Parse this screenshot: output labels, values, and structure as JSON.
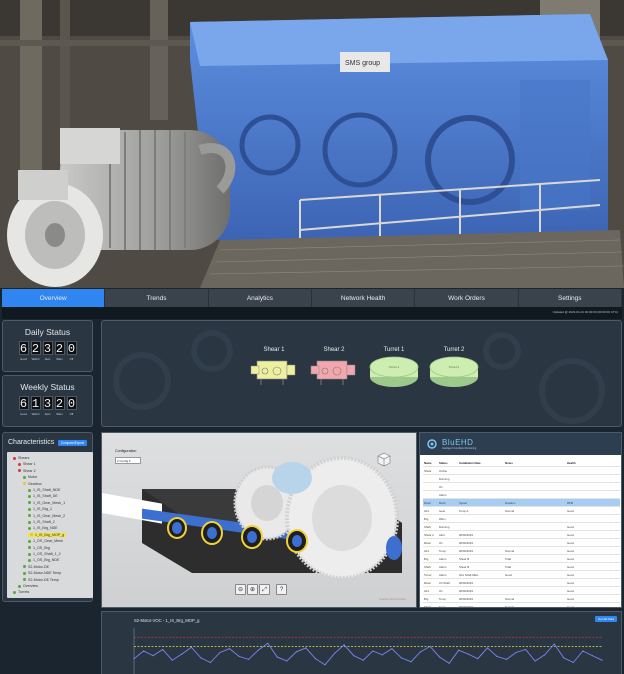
{
  "photo": {
    "nameplate": "SMS group"
  },
  "nav": {
    "tabs": [
      "Overview",
      "Trends",
      "Analytics",
      "Network Health",
      "Work Orders",
      "Settings"
    ],
    "active": 0,
    "updated_text": "Updated @ 2023-01-01 00:00:00 (00:00:00 UTC)"
  },
  "daily_status": {
    "title": "Daily Status",
    "digits": [
      "6",
      "2",
      "3",
      "2",
      "0"
    ],
    "labels": [
      "Good",
      "Watch",
      "Alert",
      "Warn",
      "Off"
    ]
  },
  "weekly_status": {
    "title": "Weekly Status",
    "digits": [
      "6",
      "1",
      "3",
      "2",
      "0"
    ],
    "labels": [
      "Good",
      "Watch",
      "Alert",
      "Warn",
      "Off"
    ]
  },
  "machines": [
    {
      "name": "Shear 1",
      "color": "#eef0a0",
      "kind": "gearbox",
      "label": ""
    },
    {
      "name": "Shear 2",
      "color": "#f2a7ae",
      "kind": "gearbox",
      "label": ""
    },
    {
      "name": "Turret 1",
      "color": "#cdeeb0",
      "kind": "turret",
      "label": "Turret 1"
    },
    {
      "name": "Turret 2",
      "color": "#cdeeb0",
      "kind": "turret",
      "label": "Turret 2"
    }
  ],
  "characteristics": {
    "title": "Characteristics",
    "button": "Compare/Export",
    "tree": [
      {
        "label": "Shears",
        "level": 0,
        "color": "#d23a3a"
      },
      {
        "label": "Shear 1",
        "level": 1,
        "color": "#d23a3a"
      },
      {
        "label": "Shear 2",
        "level": 1,
        "color": "#d23a3a"
      },
      {
        "label": "Motor",
        "level": 2,
        "color": "#58a83b"
      },
      {
        "label": "Gearbox",
        "level": 2,
        "color": "#e8c23a"
      },
      {
        "label": "1_IS_Shaft_NDE",
        "level": 3,
        "color": "#58a83b"
      },
      {
        "label": "1_IS_Shaft_DE",
        "level": 3,
        "color": "#58a83b"
      },
      {
        "label": "1_IS_Gear_Mesh_1",
        "level": 3,
        "color": "#58a83b"
      },
      {
        "label": "1_IS_Brg_1",
        "level": 3,
        "color": "#58a83b"
      },
      {
        "label": "1_IS_Gear_Mesh_2",
        "level": 3,
        "color": "#58a83b"
      },
      {
        "label": "1_IS_Shaft_2",
        "level": 3,
        "color": "#58a83b"
      },
      {
        "label": "1_IS_Brg_NDE",
        "level": 3,
        "color": "#58a83b"
      },
      {
        "label": "1_IS_Brg_MOP_g",
        "level": 3,
        "color": "#e8c23a",
        "selected": true
      },
      {
        "label": "1_OS_Gear_Mesh",
        "level": 3,
        "color": "#58a83b"
      },
      {
        "label": "1_OS_Brg",
        "level": 3,
        "color": "#58a83b"
      },
      {
        "label": "1_OS_Shaft_1_2",
        "level": 3,
        "color": "#58a83b"
      },
      {
        "label": "1_OS_Brg_NDE",
        "level": 3,
        "color": "#58a83b"
      },
      {
        "label": "S2-Motor-DE",
        "level": 2,
        "color": "#58a83b"
      },
      {
        "label": "S2-Motor-NDE Temp",
        "level": 2,
        "color": "#58a83b"
      },
      {
        "label": "S2-Motor-DE Temp",
        "level": 2,
        "color": "#58a83b"
      },
      {
        "label": "Overview",
        "level": 1,
        "color": "#58a83b"
      },
      {
        "label": "Turrets",
        "level": 0,
        "color": "#58a83b"
      }
    ]
  },
  "viewer": {
    "config_label": "Configuration",
    "config_value": "2 Config",
    "tools": [
      "⊖",
      "⊕",
      "⤢",
      "?"
    ],
    "watermark": "Gearbox Model Preview"
  },
  "table": {
    "brand": "BluEHD",
    "brand_sub": "Intelligent Condition Monitoring",
    "headers": [
      "Name",
      "Status",
      "Installation Date",
      "Notes",
      "Health"
    ],
    "rows": [
      [
        "Shear",
        "Online",
        "",
        "",
        ""
      ],
      [
        "",
        "Running",
        "",
        "",
        ""
      ],
      [
        "",
        "On",
        "",
        "",
        ""
      ],
      [
        "",
        "Alarm",
        "",
        "",
        ""
      ],
      [
        "Motor",
        "Motor",
        "Speed",
        "Rotation",
        "RPM"
      ],
      [
        "Gbx",
        "Gear",
        "Temp A",
        "Normal",
        "Good"
      ],
      [
        "Brg",
        "Warn",
        "",
        "",
        ""
      ],
      [
        "Shaft",
        "Running",
        "",
        "",
        "Good"
      ],
      [
        "Shear 2",
        "Alert",
        "00/00/2022",
        "",
        "Good"
      ],
      [
        "Motor",
        "On",
        "00/00/2022",
        "",
        "Good"
      ],
      [
        "Gbx",
        "Temp",
        "00/00/2022",
        "Normal",
        "Good"
      ],
      [
        "Brg",
        "Alarm",
        "Shear B",
        "Tidal",
        "Good"
      ],
      [
        "Shaft",
        "Alarm",
        "Shear B",
        "Tidal",
        "Good"
      ],
      [
        "Turret",
        "Alarm",
        "Gbx Shaft Main",
        "Good",
        "Good"
      ],
      [
        "Motor",
        "Ch Shaft",
        "00/00/2022",
        "",
        "Good"
      ],
      [
        "Gbx",
        "On",
        "00/00/2022",
        "",
        "Good"
      ],
      [
        "Brg",
        "Temp",
        "00/00/2022",
        "Normal",
        "Good"
      ],
      [
        "Shaft",
        "Temp",
        "00/00/2022",
        "Normal",
        "Good"
      ]
    ],
    "highlighted_row": 4
  },
  "chart_data": {
    "type": "line",
    "title": "S2-Motor-VOC - 1_IS_Brg_MOP_g",
    "button": "Get All Data",
    "series": [
      {
        "values": [
          60,
          70,
          64,
          72,
          58,
          66,
          75,
          61,
          55,
          68,
          73,
          63,
          59,
          71,
          80,
          62,
          57,
          69,
          74,
          60,
          52,
          67,
          78,
          64,
          58,
          70,
          65,
          73,
          61,
          56,
          69,
          76,
          62,
          54,
          71,
          66,
          60,
          74,
          63,
          59,
          68,
          72,
          57,
          65,
          79,
          61,
          55,
          70,
          64,
          58
        ]
      }
    ],
    "threshold_alert": 88,
    "threshold_warn": 76,
    "colors": {
      "line": "#7b86f0",
      "alert": "#e03a3a",
      "warn": "#e8d84a"
    }
  }
}
